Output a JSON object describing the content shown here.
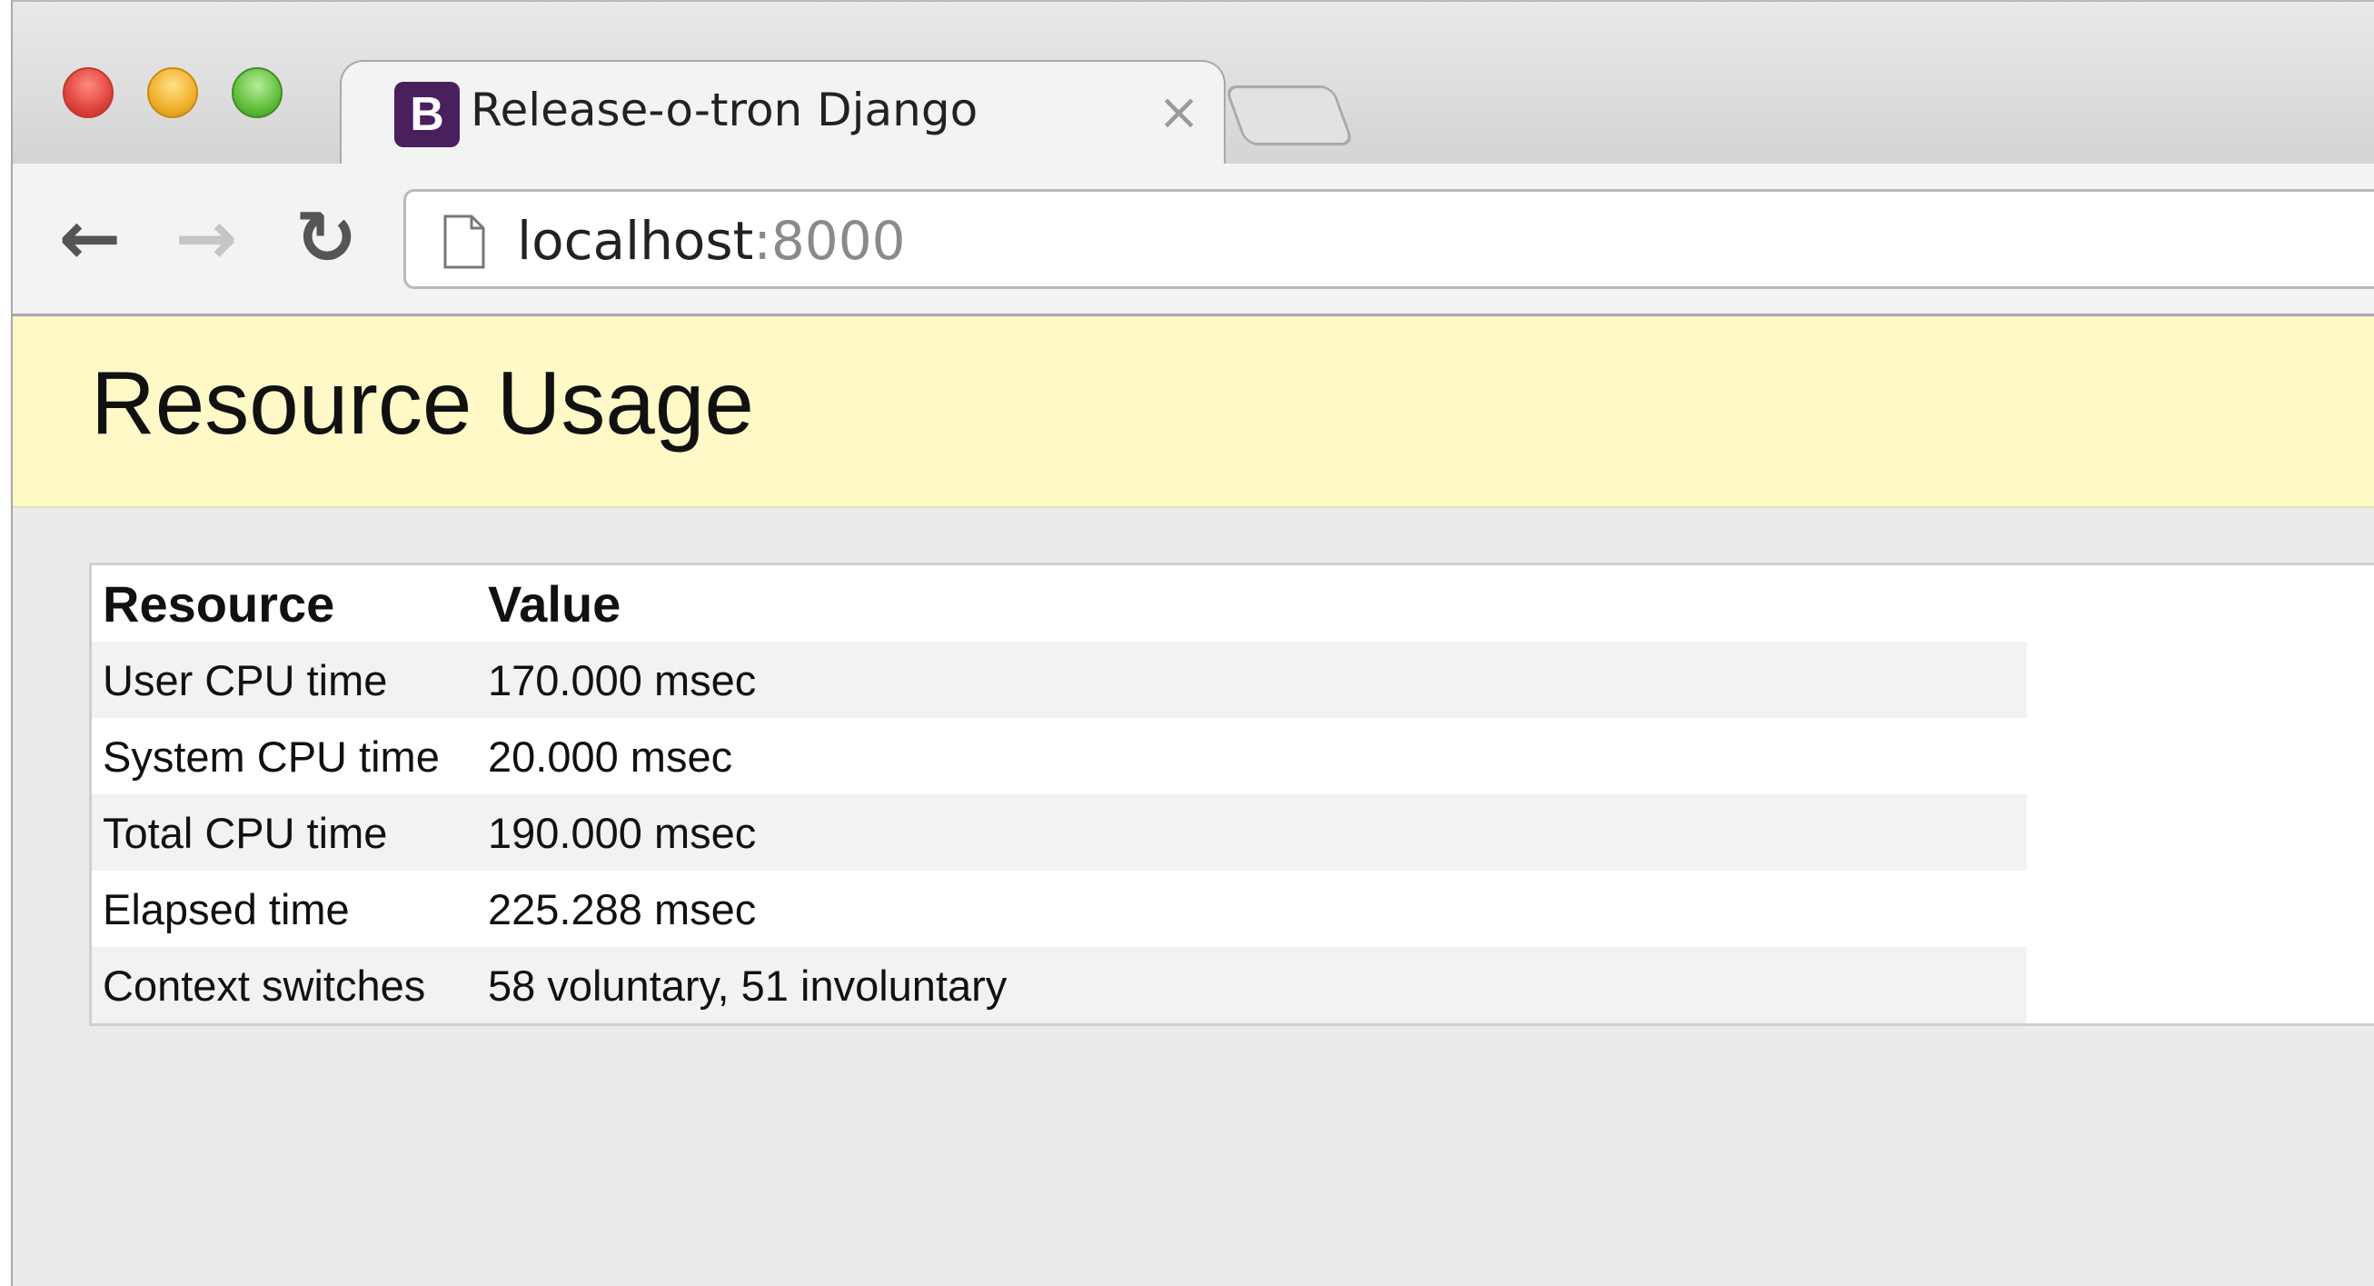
{
  "window": {
    "tab": {
      "favicon_letter": "B",
      "title": "Release-o-tron Django",
      "close_glyph": "×"
    },
    "toolbar": {
      "back_icon": "←",
      "forward_icon": "→",
      "reload_icon": "↻",
      "url_host": "localhost",
      "url_port": ":8000"
    }
  },
  "page": {
    "heading": "Resource Usage",
    "table": {
      "headers": [
        "Resource",
        "Value"
      ],
      "rows": [
        [
          "User CPU time",
          "170.000 msec"
        ],
        [
          "System CPU time",
          "20.000 msec"
        ],
        [
          "Total CPU time",
          "190.000 msec"
        ],
        [
          "Elapsed time",
          "225.288 msec"
        ],
        [
          "Context switches",
          "58 voluntary, 51 involuntary"
        ]
      ]
    }
  },
  "colors": {
    "banner_background": "#fff9c8",
    "page_background": "#ebebeb",
    "favicon_background": "#4a1f5e"
  }
}
